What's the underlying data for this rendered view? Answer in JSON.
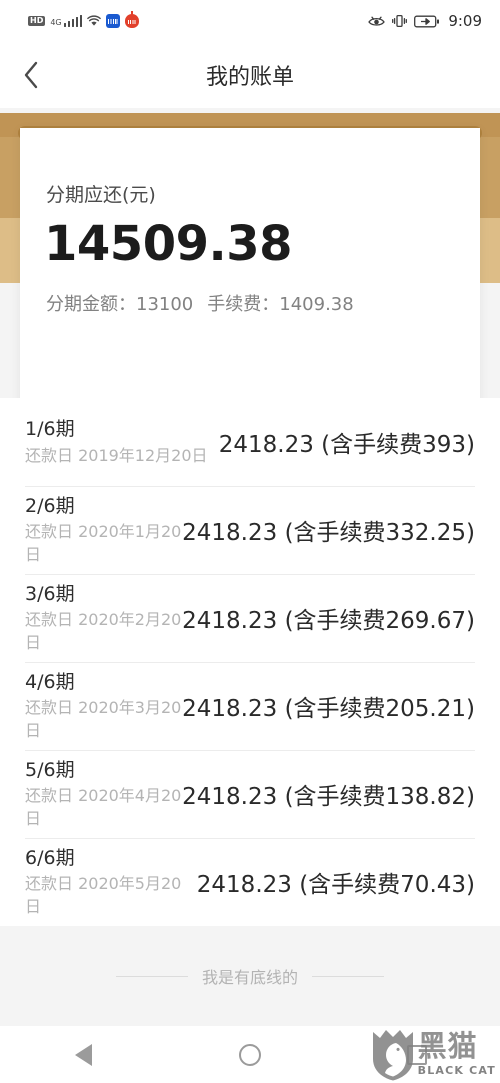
{
  "statusbar": {
    "hd_badge": "HD",
    "network_label": "4G",
    "icons": [
      "hd-icon",
      "signal-icon",
      "wifi-icon",
      "app-blue-icon",
      "app-red-icon",
      "eye-icon",
      "vibrate-icon",
      "battery-charging-icon"
    ],
    "time": "9:09"
  },
  "titlebar": {
    "back_icon": "chevron-left-icon",
    "title": "我的账单"
  },
  "receipt": {
    "label": "分期应还(元)",
    "amount": "14509.38",
    "principal_label": "分期金额：",
    "principal_value": "13100",
    "fee_label": "手续费：",
    "fee_value": "1409.38",
    "accent_gold": "#c8a063",
    "accent_gold_light": "#ddbd87",
    "accent_gold_dark": "#b0833f"
  },
  "installments": [
    {
      "term": "1/6期",
      "date": "还款日 2019年12月20日",
      "amount": "2418.23 (含手续费393)"
    },
    {
      "term": "2/6期",
      "date": "还款日 2020年1月20日",
      "amount": "2418.23 (含手续费332.25)"
    },
    {
      "term": "3/6期",
      "date": "还款日 2020年2月20日",
      "amount": "2418.23 (含手续费269.67)"
    },
    {
      "term": "4/6期",
      "date": "还款日 2020年3月20日",
      "amount": "2418.23 (含手续费205.21)"
    },
    {
      "term": "5/6期",
      "date": "还款日 2020年4月20日",
      "amount": "2418.23 (含手续费138.82)"
    },
    {
      "term": "6/6期",
      "date": "还款日 2020年5月20日",
      "amount": "2418.23 (含手续费70.43)"
    }
  ],
  "bottom_hint": {
    "text": "我是有底线的"
  },
  "navbar": {
    "back_label": "back-triangle-icon",
    "home_label": "home-circle-icon",
    "recents_label": "recents-square-icon"
  },
  "watermark": {
    "cn": "黑猫",
    "en": "BLACK CAT"
  }
}
